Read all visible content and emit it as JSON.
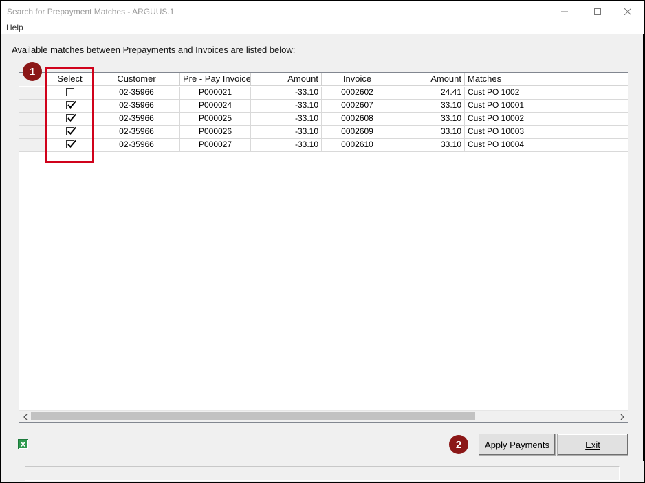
{
  "window": {
    "title": "Search for Prepayment Matches - ARGUUS.1",
    "controls": [
      "minimize-icon",
      "maximize-icon",
      "close-icon"
    ]
  },
  "menu": {
    "help": "Help"
  },
  "instructions": "Available matches between Prepayments and Invoices are listed below:",
  "table": {
    "headers": {
      "select": "Select",
      "customer": "Customer",
      "prepay_invoice": "Pre - Pay  Invoice",
      "amount1": "Amount",
      "invoice": "Invoice",
      "amount2": "Amount",
      "matches": "Matches"
    },
    "rows": [
      {
        "selected": false,
        "customer": "02-35966",
        "prepay_invoice": "P000021",
        "amount1": "-33.10",
        "invoice": "0002602",
        "amount2": "24.41",
        "matches": "Cust PO 1002"
      },
      {
        "selected": true,
        "customer": "02-35966",
        "prepay_invoice": "P000024",
        "amount1": "-33.10",
        "invoice": "0002607",
        "amount2": "33.10",
        "matches": "Cust PO 10001"
      },
      {
        "selected": true,
        "customer": "02-35966",
        "prepay_invoice": "P000025",
        "amount1": "-33.10",
        "invoice": "0002608",
        "amount2": "33.10",
        "matches": "Cust PO 10002"
      },
      {
        "selected": true,
        "customer": "02-35966",
        "prepay_invoice": "P000026",
        "amount1": "-33.10",
        "invoice": "0002609",
        "amount2": "33.10",
        "matches": "Cust PO 10003"
      },
      {
        "selected": true,
        "customer": "02-35966",
        "prepay_invoice": "P000027",
        "amount1": "-33.10",
        "invoice": "0002610",
        "amount2": "33.10",
        "matches": "Cust PO 10004"
      }
    ]
  },
  "annotations": {
    "badge1": "1",
    "badge2": "2",
    "highlight_color": "#d0021b",
    "badge_color": "#8b1717"
  },
  "buttons": {
    "apply": "Apply Payments",
    "exit": "Exit"
  },
  "icons": {
    "export": "excel-icon"
  }
}
